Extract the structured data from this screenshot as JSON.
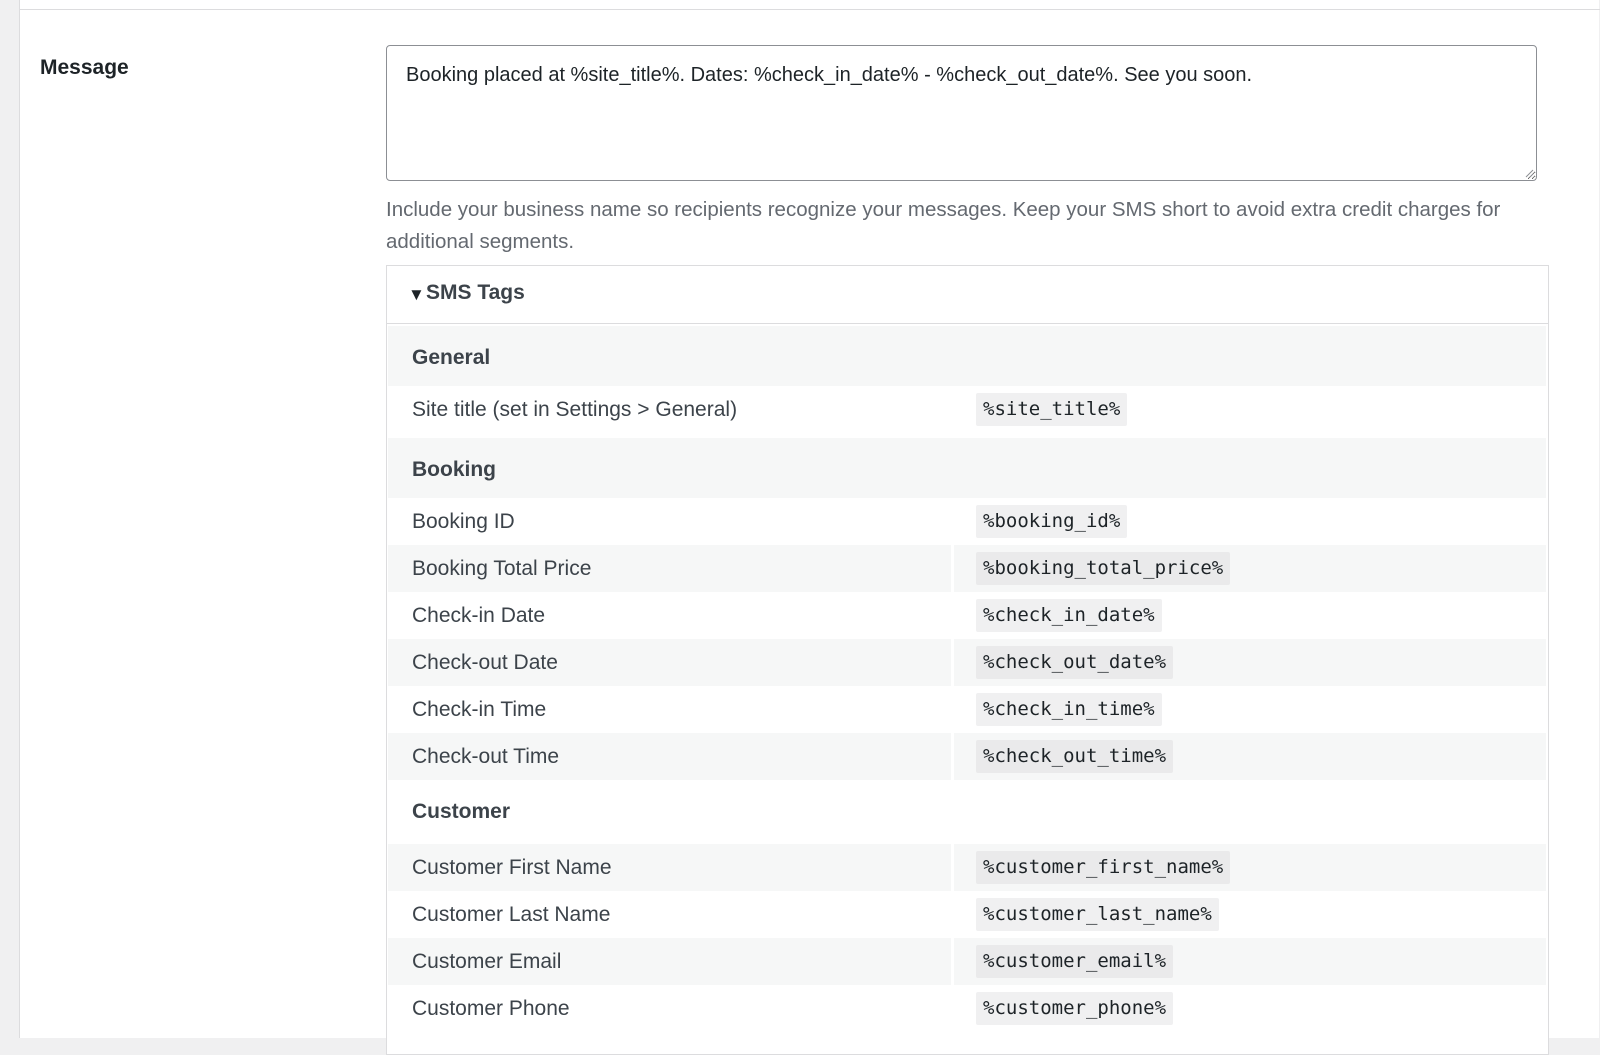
{
  "message": {
    "label": "Message",
    "value": "Booking placed at %site_title%. Dates: %check_in_date% - %check_out_date%. See you soon.",
    "description": "Include your business name so recipients recognize your messages. Keep your SMS short to avoid extra credit charges for additional segments."
  },
  "sms_tags": {
    "summary_arrow": "▼",
    "summary_label": "SMS Tags",
    "groups": {
      "general": {
        "label": "General",
        "items": [
          {
            "desc": "Site title (set in Settings > General)",
            "tag": "%site_title%"
          }
        ]
      },
      "booking": {
        "label": "Booking",
        "items": [
          {
            "desc": "Booking ID",
            "tag": "%booking_id%"
          },
          {
            "desc": "Booking Total Price",
            "tag": "%booking_total_price%"
          },
          {
            "desc": "Check-in Date",
            "tag": "%check_in_date%"
          },
          {
            "desc": "Check-out Date",
            "tag": "%check_out_date%"
          },
          {
            "desc": "Check-in Time",
            "tag": "%check_in_time%"
          },
          {
            "desc": "Check-out Time",
            "tag": "%check_out_time%"
          }
        ]
      },
      "customer": {
        "label": "Customer",
        "items": [
          {
            "desc": "Customer First Name",
            "tag": "%customer_first_name%"
          },
          {
            "desc": "Customer Last Name",
            "tag": "%customer_last_name%"
          },
          {
            "desc": "Customer Email",
            "tag": "%customer_email%"
          },
          {
            "desc": "Customer Phone",
            "tag": "%customer_phone%"
          }
        ]
      }
    }
  }
}
